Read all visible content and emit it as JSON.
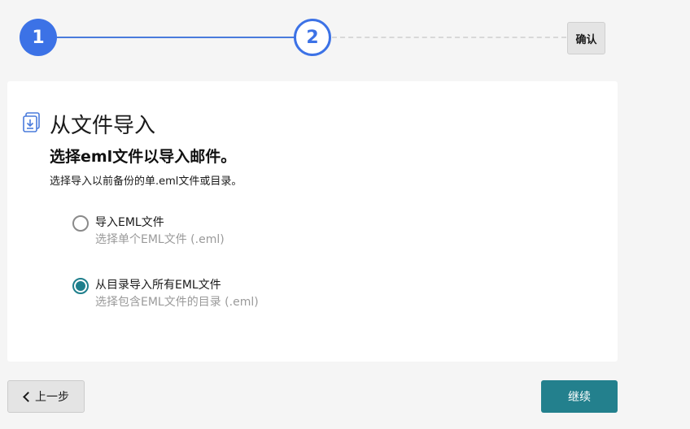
{
  "stepper": {
    "step1_label": "1",
    "step2_label": "2",
    "confirm_label": "确认",
    "active_color": "#3c72e6"
  },
  "card": {
    "title": "从文件导入",
    "subtitle": "选择eml文件以导入邮件。",
    "description": "选择导入以前备份的单.eml文件或目录。",
    "icon": "import-file-icon"
  },
  "options": [
    {
      "label": "导入EML文件",
      "hint": "选择单个EML文件 (.eml)",
      "selected": false
    },
    {
      "label": "从目录导入所有EML文件",
      "hint": "选择包含EML文件的目录 (.eml)",
      "selected": true
    }
  ],
  "footer": {
    "back_label": "上一步",
    "continue_label": "继续",
    "continue_color": "#23808d"
  }
}
